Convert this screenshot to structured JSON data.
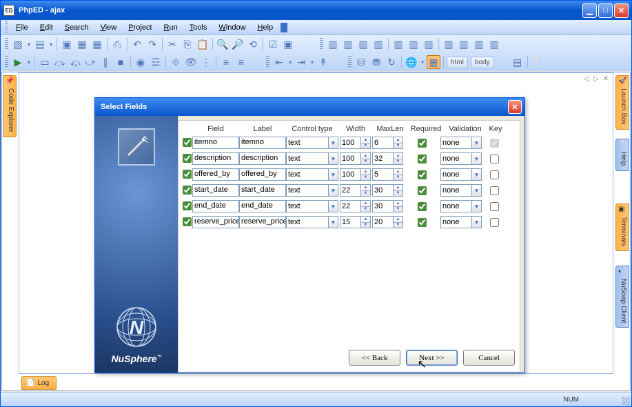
{
  "window": {
    "title": "PhpED - ajax"
  },
  "menu": {
    "file": "File",
    "edit": "Edit",
    "search": "Search",
    "view": "View",
    "project": "Project",
    "run": "Run",
    "tools": "Tools",
    "window": "Window",
    "help": "Help"
  },
  "breadcrumb": [
    "html",
    "body"
  ],
  "sidetabs": {
    "code_explorer": "Code Explorer",
    "launch_box": "Launch Box",
    "help": "Help",
    "terminals": "Terminals",
    "nusoap": "NuSoap Client",
    "log": "Log"
  },
  "dialog": {
    "title": "Select Fields",
    "logo": "NuSphere",
    "headers": {
      "field": "Field",
      "label": "Label",
      "control": "Control type",
      "width": "Width",
      "maxlen": "MaxLen",
      "required": "Required",
      "validation": "Validation",
      "key": "Key"
    },
    "rows": [
      {
        "on": true,
        "field": "itemno",
        "label": "itemno",
        "control": "text",
        "width": "100",
        "maxlen": "6",
        "required": true,
        "validation": "none",
        "key": true
      },
      {
        "on": true,
        "field": "description",
        "label": "description",
        "control": "text",
        "width": "100",
        "maxlen": "32",
        "required": true,
        "validation": "none",
        "key": false
      },
      {
        "on": true,
        "field": "offered_by",
        "label": "offered_by",
        "control": "text",
        "width": "100",
        "maxlen": "5",
        "required": true,
        "validation": "none",
        "key": false
      },
      {
        "on": true,
        "field": "start_date",
        "label": "start_date",
        "control": "text",
        "width": "22",
        "maxlen": "30",
        "required": true,
        "validation": "none",
        "key": false
      },
      {
        "on": true,
        "field": "end_date",
        "label": "end_date",
        "control": "text",
        "width": "22",
        "maxlen": "30",
        "required": true,
        "validation": "none",
        "key": false
      },
      {
        "on": true,
        "field": "reserve_price",
        "label": "reserve_price",
        "control": "text",
        "width": "15",
        "maxlen": "20",
        "required": true,
        "validation": "none",
        "key": false
      }
    ],
    "buttons": {
      "back": "<< Back",
      "next": "Next >>",
      "cancel": "Cancel"
    }
  },
  "status": {
    "num": "NUM"
  }
}
